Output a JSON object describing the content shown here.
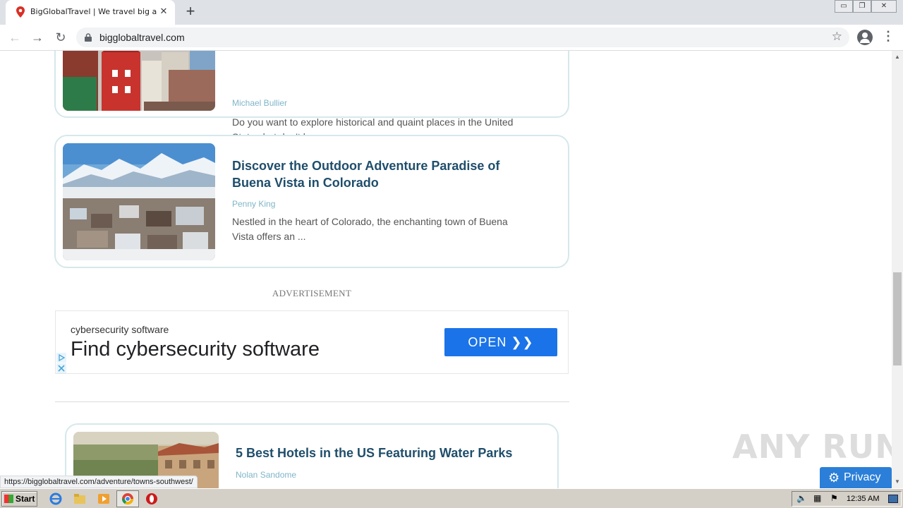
{
  "browser": {
    "tab_title": "BigGlobalTravel | We travel big and g",
    "tab_close": "✕",
    "new_tab": "+",
    "url": "bigglobaltravel.com",
    "window_controls": [
      "▭",
      "❐",
      "✕"
    ]
  },
  "articles": [
    {
      "title": "",
      "author": "Michael Bullier",
      "excerpt": "Do you want to explore historical and quaint places in the United States but don't know ..."
    },
    {
      "title": "Discover the Outdoor Adventure Paradise of Buena Vista in Colorado",
      "author": "Penny King",
      "excerpt": "Nestled in the heart of Colorado, the enchanting town of Buena Vista offers an ..."
    },
    {
      "title": "5 Best Hotels in the US Featuring Water Parks",
      "author": "Nolan Sandome",
      "excerpt": ""
    }
  ],
  "ad": {
    "label": "ADVERTISEMENT",
    "small_text": "cybersecurity software",
    "headline": "Find cybersecurity software",
    "button": "OPEN ❯❯"
  },
  "status_url": "https://bigglobaltravel.com/adventure/towns-southwest/",
  "privacy_label": "Privacy",
  "watermark": "ANY RUN",
  "taskbar": {
    "start_label": "Start",
    "clock": "12:35 AM"
  },
  "colors": {
    "title": "#1f4e6b",
    "author": "#7fb5c9",
    "card_border": "#d5e8ec",
    "ad_button": "#1a73e8",
    "privacy_bg": "#2b7fd8"
  }
}
